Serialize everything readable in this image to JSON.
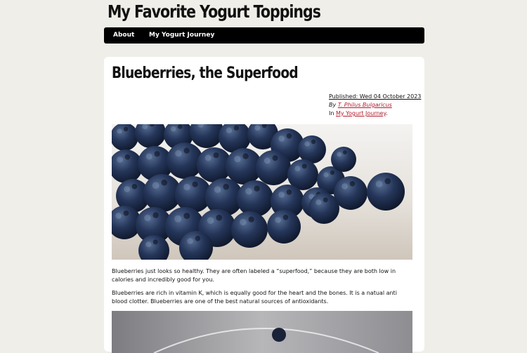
{
  "site": {
    "title": "My Favorite Yogurt Toppings"
  },
  "nav": {
    "items": [
      {
        "label": "About"
      },
      {
        "label": "My Yogurt Journey"
      }
    ]
  },
  "post": {
    "title": "Blueberries, the Superfood",
    "published": "Published: Wed 04 October 2023",
    "by_prefix": "By ",
    "author": "T. Philus Bulgaricus",
    "in_prefix": "In ",
    "category": "My Yogurt Journey",
    "in_suffix": ".",
    "paragraphs": [
      "Blueberries just looks so healthy. They are often labeled a “superfood,” because they are both low in calories and incredibly good for you.",
      "Blueberries are rich in vitamin K, which is equally good for the heart and the bones. It is a natual anti blood clotter. Blueberries are one of the best natural sources of antioxidants."
    ]
  },
  "colors": {
    "background": "#efeee8",
    "nav_bg": "#000000",
    "link": "#b01c2e",
    "card": "#ffffff"
  }
}
